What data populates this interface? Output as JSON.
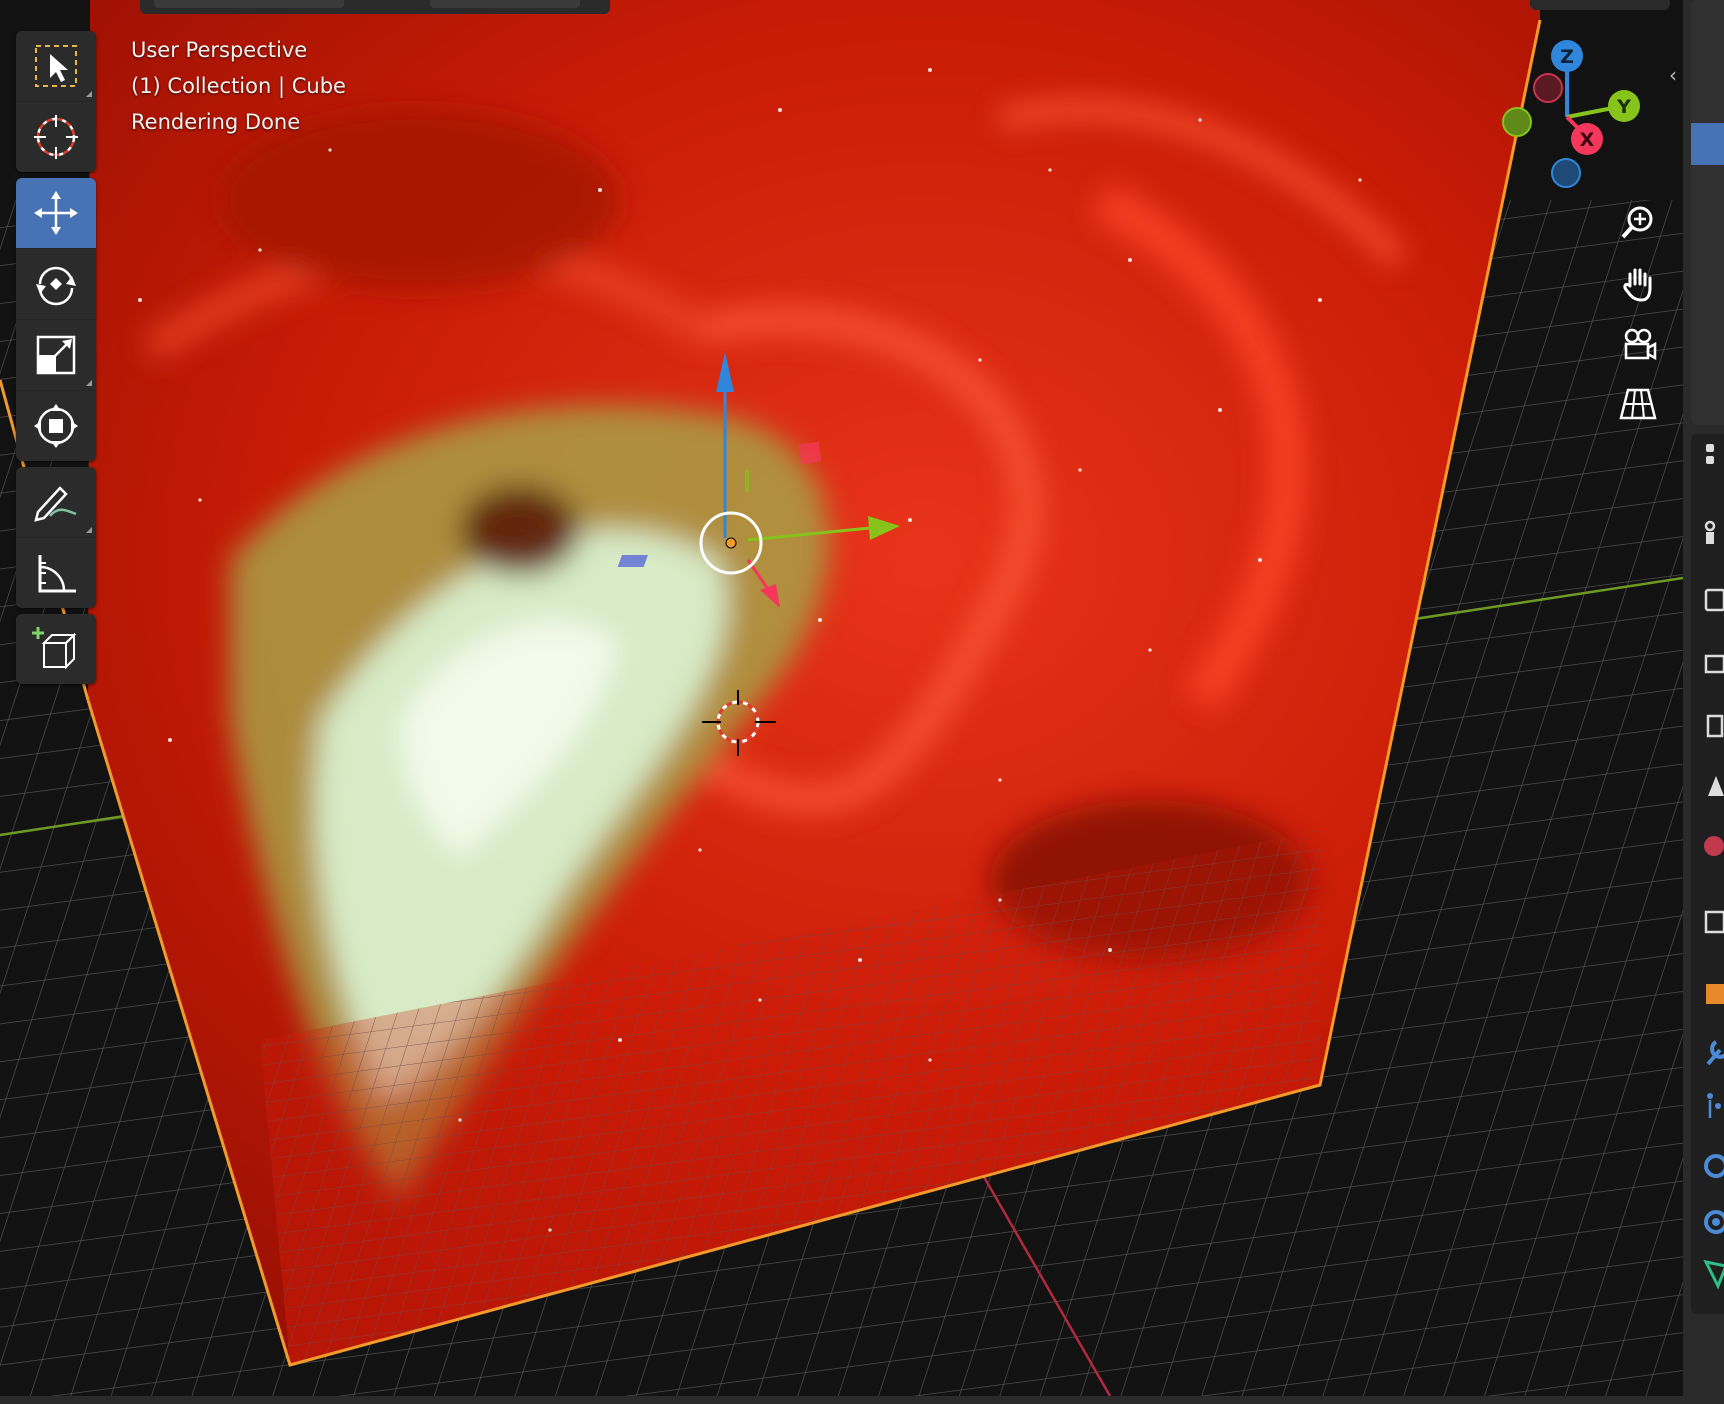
{
  "viewport": {
    "overlay": {
      "line1": "User Perspective",
      "line2": "(1) Collection | Cube",
      "line3": "Rendering Done"
    }
  },
  "toolbar": {
    "tools": [
      {
        "name": "select-box",
        "icon": "select-box-icon",
        "active": false
      },
      {
        "name": "cursor",
        "icon": "cursor-icon",
        "active": false
      },
      {
        "name": "move",
        "icon": "move-icon",
        "active": true
      },
      {
        "name": "rotate",
        "icon": "rotate-icon",
        "active": false
      },
      {
        "name": "scale",
        "icon": "scale-icon",
        "active": false
      },
      {
        "name": "transform",
        "icon": "transform-icon",
        "active": false
      },
      {
        "name": "annotate",
        "icon": "annotate-icon",
        "active": false
      },
      {
        "name": "measure",
        "icon": "measure-icon",
        "active": false
      },
      {
        "name": "add-cube",
        "icon": "add-cube-icon",
        "active": false
      }
    ]
  },
  "gizmo": {
    "z_label": "Z",
    "y_label": "Y",
    "x_label": "X",
    "colors": {
      "x": "#f5375c",
      "y": "#86c41b",
      "z": "#2f86db"
    }
  },
  "navigation": [
    "zoom-icon",
    "pan-hand-icon",
    "camera-icon",
    "perspective-grid-icon"
  ],
  "colors": {
    "accent": "#4772b3",
    "selection_outline": "#f39a2a",
    "nebula_red": "#c41a05",
    "nebula_green": "#cfe6c0"
  }
}
